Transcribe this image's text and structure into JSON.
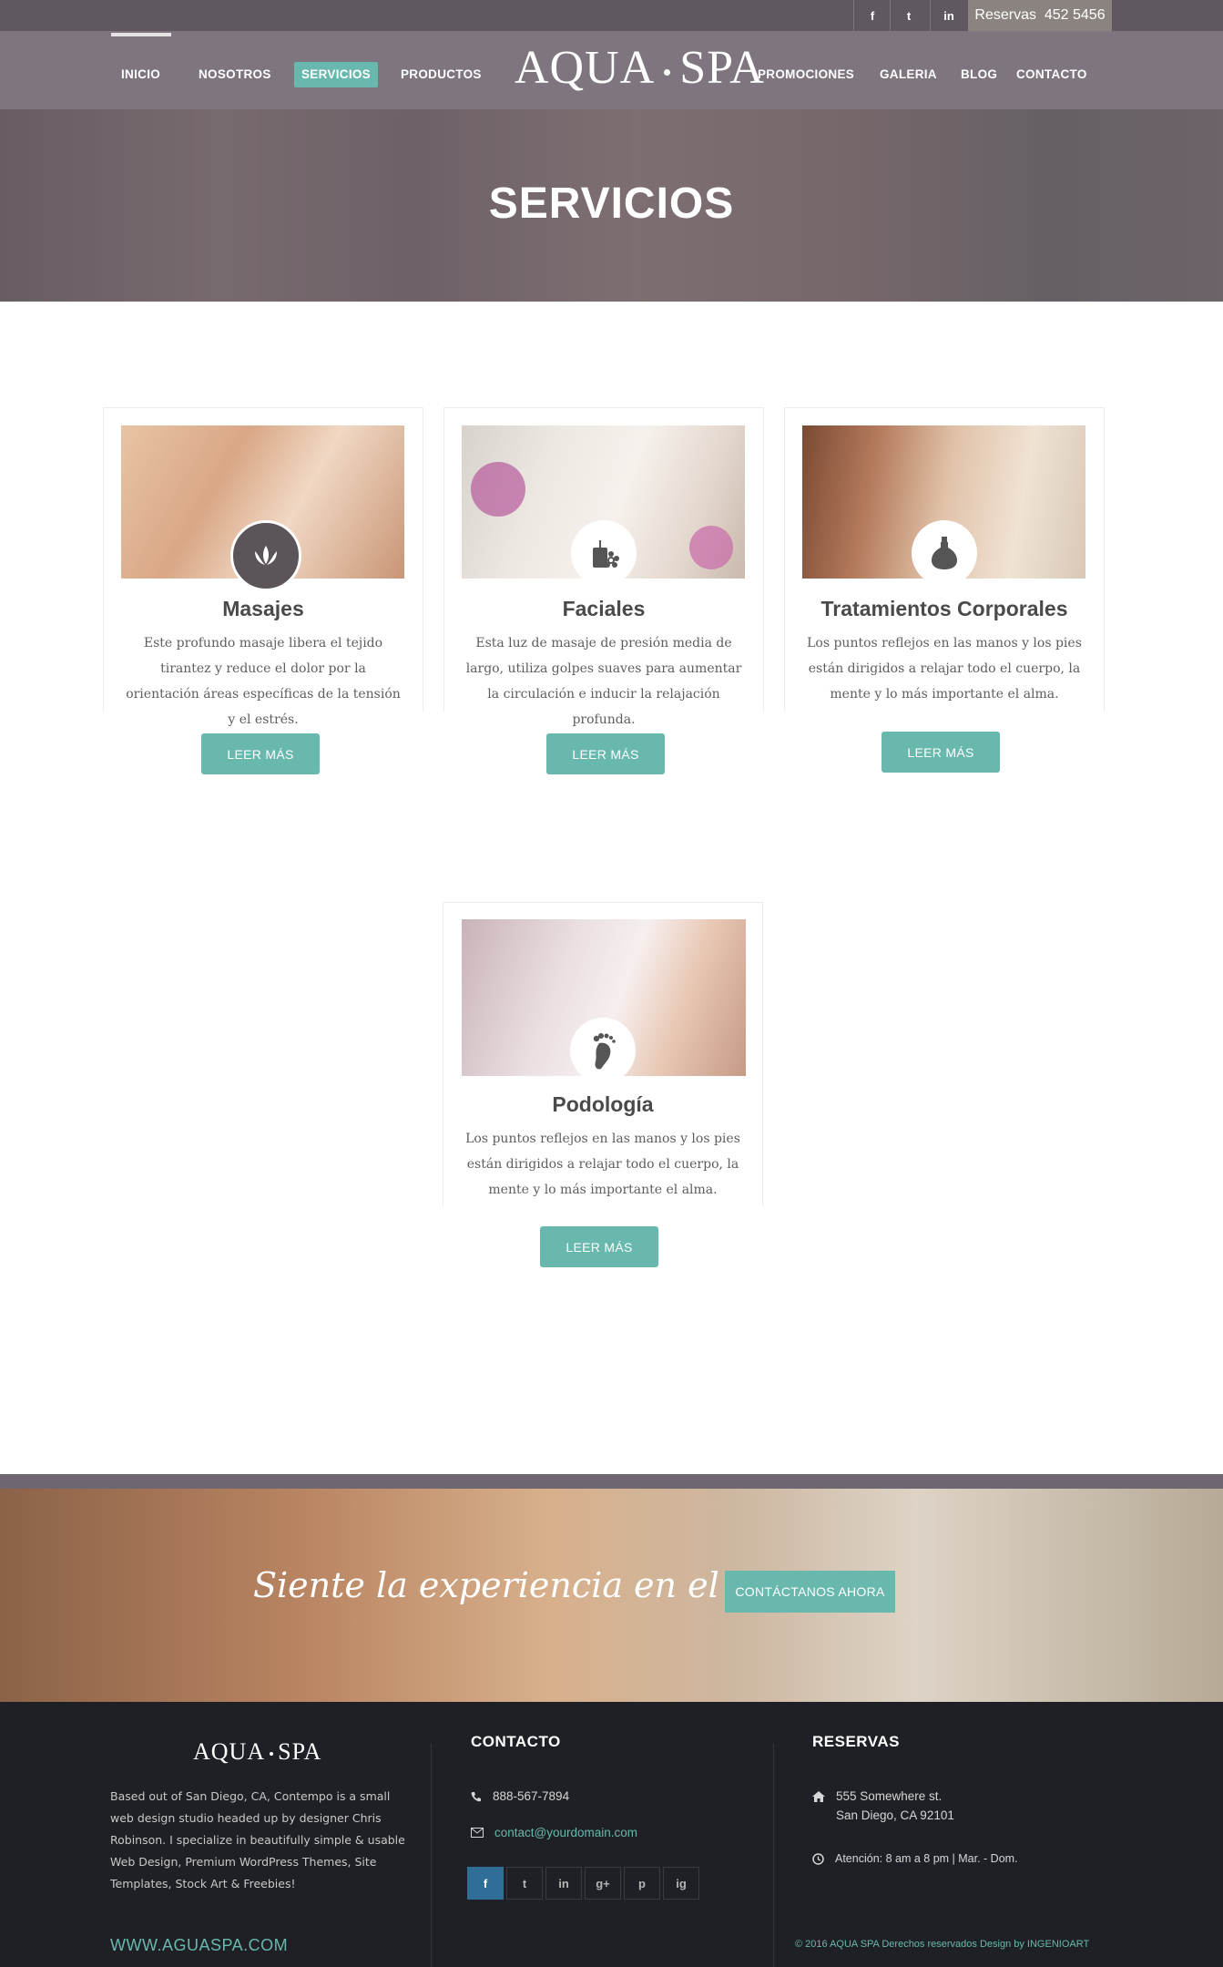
{
  "topbar": {
    "social": [
      "f",
      "t",
      "in"
    ],
    "reservations_label": "Reservas",
    "reservations_phone": "452 5456"
  },
  "nav": {
    "left": [
      "INICIO",
      "NOSOTROS",
      "SERVICIOS",
      "PRODUCTOS"
    ],
    "right": [
      "PROMOCIONES",
      "GALERIA",
      "BLOG",
      "CONTACTO"
    ],
    "active": "SERVICIOS",
    "logo_left": "AQUA",
    "logo_right": "SPA"
  },
  "hero": {
    "title": "SERVICIOS"
  },
  "services": [
    {
      "title": "Masajes",
      "text": "Este profundo masaje libera el tejido tirantez y reduce el dolor por la orientación áreas específicas de la tensión y el estrés.",
      "button": "LEER MÁS",
      "icon": "lotus-icon"
    },
    {
      "title": "Faciales",
      "text": "Esta luz de masaje de presión media de largo, utiliza golpes suaves para aumentar la circulación e inducir la relajación profunda.",
      "button": "LEER MÁS",
      "icon": "candle-flower-icon"
    },
    {
      "title": "Tratamientos Corporales",
      "text": "Los puntos reflejos en las manos y los pies están dirigidos a relajar todo el cuerpo, la mente y lo más importante el alma.",
      "button": "LEER MÁS",
      "icon": "oil-bottle-icon"
    },
    {
      "title": "Podología",
      "text": "Los puntos reflejos en las manos y los pies están dirigidos a relajar todo el cuerpo, la mente y lo más importante el alma.",
      "button": "LEER MÁS",
      "icon": "foot-icon"
    }
  ],
  "band": {
    "script": "Siente la experiencia en el Spa",
    "button": "CONTÁCTANOS  AHORA"
  },
  "footer": {
    "logo_left": "AQUA",
    "logo_right": "SPA",
    "about": "Based out of San Diego, CA, Contempo is a small web design studio headed up by designer Chris Robinson. I specialize in beautifully simple & usable Web Design, Premium WordPress Themes, Site Templates, Stock Art & Freebies!",
    "website": "WWW.AGUASPA.COM",
    "contact_heading": "CONTACTO",
    "phone": "888-567-7894",
    "email": "contact@yourdomain.com",
    "social": [
      "f",
      "t",
      "in",
      "g+",
      "p",
      "ig"
    ],
    "reservations_heading": "RESERVAS",
    "address_line1": "555 Somewhere st.",
    "address_line2": "San Diego, CA 92101",
    "hours": "Atención: 8 am a 8 pm  |  Mar. - Dom.",
    "copyright": "© 2016   AQUA SPA   Derechos reservados Design by INGENIOART"
  },
  "colors": {
    "accent": "#68b8ad",
    "nav_bg": "#746a74",
    "footer_bg": "#1f2025"
  }
}
